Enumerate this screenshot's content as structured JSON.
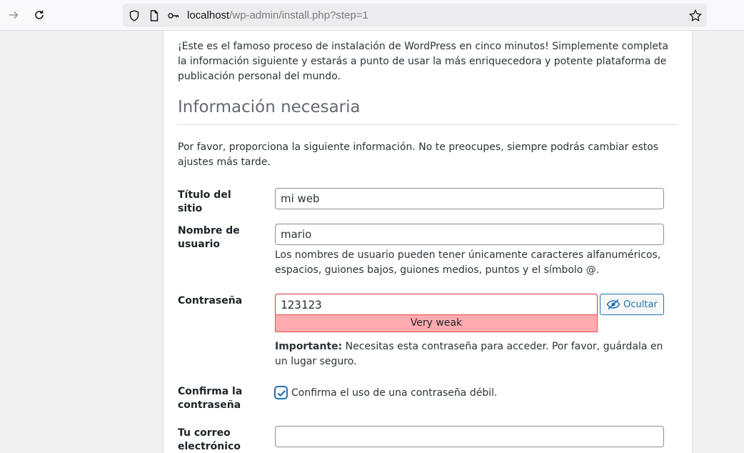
{
  "browser": {
    "url_host": "localhost",
    "url_path": "/wp-admin/install.php?step=1"
  },
  "page": {
    "intro": "¡Este es el famoso proceso de instalación de WordPress en cinco minutos! Simplemente completa la información siguiente y estarás a punto de usar la más enriquecedora y potente plataforma de publicación personal del mundo.",
    "heading": "Información necesaria",
    "description": "Por favor, proporciona la siguiente información. No te preocupes, siempre podrás cambiar estos ajustes más tarde."
  },
  "form": {
    "site_title": {
      "label": "Título del sitio",
      "value": "mi web"
    },
    "username": {
      "label": "Nombre de usuario",
      "value": "mario",
      "hint": "Los nombres de usuario pueden tener únicamente caracteres alfanuméricos, espacios, guiones bajos, guiones medios, puntos y el símbolo @."
    },
    "password": {
      "label": "Contraseña",
      "value": "123123",
      "strength": "Very weak",
      "toggle_label": "Ocultar",
      "note_strong": "Importante:",
      "note": " Necesitas esta contraseña para acceder. Por favor, guárdala en un lugar seguro."
    },
    "confirm": {
      "label": "Confirma la contraseña",
      "checkbox_label": "Confirma el uso de una contraseña débil.",
      "checked": true
    },
    "email": {
      "label": "Tu correo electrónico",
      "value": ""
    }
  },
  "colors": {
    "accent": "#2271b1",
    "weak_bg": "#ffabaf",
    "weak_border": "#d63638"
  }
}
